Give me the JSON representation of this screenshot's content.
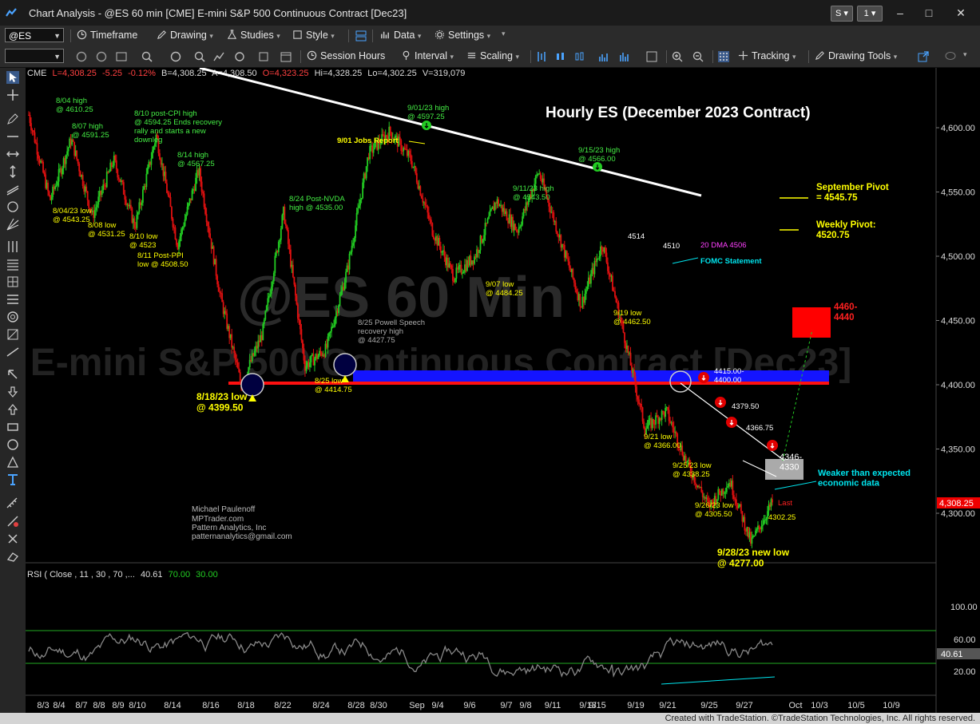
{
  "window": {
    "title": "Chart Analysis - @ES 60 min [CME] E-mini S&P 500 Continuous Contract [Dec23]",
    "btn_s": "S",
    "btn_1": "1"
  },
  "toolbar1": {
    "symbol": "@ES",
    "timeframe": "Timeframe",
    "drawing": "Drawing",
    "studies": "Studies",
    "style": "Style",
    "data": "Data",
    "settings": "Settings"
  },
  "toolbar2": {
    "session_hours": "Session Hours",
    "interval": "Interval",
    "scaling": "Scaling",
    "tracking": "Tracking",
    "drawing_tools": "Drawing Tools"
  },
  "header": {
    "exchange": "CME",
    "last": "L=4,308.25",
    "change": "-5.25",
    "pct": "-0.12%",
    "bid": "B=4,308.25",
    "ask": "A=4,308.50",
    "open": "O=4,323.25",
    "high": "Hi=4,328.25",
    "low": "Lo=4,302.25",
    "volume": "V=319,079"
  },
  "colors": {
    "up": "#22cc22",
    "down": "#e01010",
    "resistance": "#ff0000",
    "support": "#0000ff",
    "label_green": "#44ee44",
    "label_yellow": "#ffff00",
    "label_cyan": "#00e5ee"
  },
  "chart_data": {
    "type": "candlestick",
    "title": "Hourly ES (December 2023 Contract)",
    "watermark": [
      "@ES 60 Min",
      "E-mini S&P 500 Continuous Contract [Dec23]"
    ],
    "y_ticks": [
      "4,600.00",
      "4,550.00",
      "4,500.00",
      "4,450.00",
      "4,400.00",
      "4,350.00",
      "4,300.00"
    ],
    "last_price_tag": "4,308.25",
    "ylim": [
      4265,
      4640
    ],
    "x_ticks": [
      "8/3",
      "8/4",
      "8/7",
      "8/8",
      "8/9",
      "8/10",
      "8/14",
      "8/16",
      "8/18",
      "8/22",
      "8/24",
      "8/28",
      "8/30",
      "Sep",
      "9/4",
      "9/6",
      "9/7",
      "9/8",
      "9/11",
      "9/13",
      "9/15",
      "9/19",
      "9/21",
      "9/25",
      "9/27",
      "Oct",
      "10/3",
      "10/5",
      "10/9"
    ],
    "series": [
      {
        "date": "8/3",
        "close": 4610
      },
      {
        "date": "8/4",
        "close": 4543.25
      },
      {
        "date": "8/7",
        "close": 4591.25
      },
      {
        "date": "8/8",
        "close": 4531.25
      },
      {
        "date": "8/9",
        "close": 4575
      },
      {
        "date": "8/10",
        "close": 4523
      },
      {
        "date": "8/10",
        "close": 4594.25
      },
      {
        "date": "8/11",
        "close": 4508.5
      },
      {
        "date": "8/14",
        "close": 4567.25
      },
      {
        "date": "8/16",
        "close": 4470
      },
      {
        "date": "8/18",
        "close": 4399.5
      },
      {
        "date": "8/22",
        "close": 4440
      },
      {
        "date": "8/24",
        "close": 4535
      },
      {
        "date": "8/25",
        "close": 4414.75
      },
      {
        "date": "8/25",
        "close": 4427.75
      },
      {
        "date": "8/28",
        "close": 4490
      },
      {
        "date": "8/30",
        "close": 4580
      },
      {
        "date": "Sep",
        "close": 4597.25
      },
      {
        "date": "9/4",
        "close": 4575
      },
      {
        "date": "9/6",
        "close": 4520
      },
      {
        "date": "9/7",
        "close": 4484.25
      },
      {
        "date": "9/8",
        "close": 4500
      },
      {
        "date": "9/11",
        "close": 4543.5
      },
      {
        "date": "9/13",
        "close": 4520
      },
      {
        "date": "9/15",
        "close": 4566
      },
      {
        "date": "9/15",
        "close": 4514
      },
      {
        "date": "9/19",
        "close": 4462.5
      },
      {
        "date": "9/19",
        "close": 4510
      },
      {
        "date": "9/21",
        "close": 4440
      },
      {
        "date": "9/21",
        "close": 4366
      },
      {
        "date": "9/22",
        "close": 4379.5
      },
      {
        "date": "9/25",
        "close": 4338.25
      },
      {
        "date": "9/26",
        "close": 4305.5
      },
      {
        "date": "9/27",
        "close": 4325
      },
      {
        "date": "9/28",
        "close": 4277
      },
      {
        "date": "9/28",
        "close": 4308.25
      }
    ],
    "annotations": [
      {
        "text": "8/04 high",
        "text2": "@ 4610.25",
        "color": "green"
      },
      {
        "text": "8/07 high",
        "text2": "@ 4591.25",
        "color": "green"
      },
      {
        "text": "8/10 post-CPI high",
        "text2": "@ 4594.25 Ends recovery",
        "text3": "rally and starts a new",
        "text4": "downleg",
        "color": "green"
      },
      {
        "text": "8/14 high",
        "text2": "@ 4567.25",
        "color": "green"
      },
      {
        "text": "8/04/23 low",
        "text2": "@ 4543.25",
        "color": "yellow"
      },
      {
        "text": "8/08 low",
        "text2": "@ 4531.25",
        "color": "yellow"
      },
      {
        "text": "8/10 low",
        "text2": "@ 4523",
        "color": "yellow"
      },
      {
        "text": "8/11 Post-PPI",
        "text2": "low @ 4508.50",
        "color": "yellow"
      },
      {
        "text": "8/24 Post-NVDA",
        "text2": "high @ 4535.00",
        "color": "green"
      },
      {
        "text": "9/01/23 high",
        "text2": "@ 4597.25",
        "color": "green"
      },
      {
        "text": "9/01 Jobs Report",
        "color": "yellow"
      },
      {
        "text": "9/11/23 high",
        "text2": "@ 4543.50",
        "color": "green"
      },
      {
        "text": "9/15/23 high",
        "text2": "@ 4566.00",
        "color": "green"
      },
      {
        "text": "9/07 low",
        "text2": "@ 4484.25",
        "color": "yellow"
      },
      {
        "text": "4514",
        "color": "white"
      },
      {
        "text": "4510",
        "color": "white"
      },
      {
        "text": "20 DMA 4506",
        "color": "magenta"
      },
      {
        "text": "FOMC Statement",
        "color": "cyan"
      },
      {
        "text": "9/19 low",
        "text2": "@ 4462.50",
        "color": "yellow"
      },
      {
        "text": "8/25 Powell Speech",
        "text2": "recovery high",
        "text3": "@ 4427.75",
        "color": "gray"
      },
      {
        "text": "8/25 low",
        "text2": "@ 4414.75",
        "color": "yellow"
      },
      {
        "text": "8/18/23 low",
        "text2": "@ 4399.50",
        "color": "yellow"
      },
      {
        "text": "4415.00-",
        "text2": "4400.00",
        "color": "white"
      },
      {
        "text": "4379.50",
        "color": "white"
      },
      {
        "text": "4366.75",
        "color": "white"
      },
      {
        "text": "9/21 low",
        "text2": "@ 4366.00",
        "color": "yellow"
      },
      {
        "text": "9/25/23 low",
        "text2": "@ 4338.25",
        "color": "yellow"
      },
      {
        "text": "4346-",
        "text2": "4330",
        "color": "white"
      },
      {
        "text": "Weaker than expected",
        "text2": "economic data",
        "color": "cyan"
      },
      {
        "text": "9/26/23 low",
        "text2": "@ 4305.50",
        "color": "yellow"
      },
      {
        "text": "4302.25",
        "color": "yellow"
      },
      {
        "text": "Last",
        "color": "red"
      },
      {
        "text": "9/28/23 new low",
        "text2": "@ 4277.00",
        "color": "yellow"
      },
      {
        "text": "4460-",
        "text2": "4440",
        "color": "red"
      },
      {
        "text": "September Pivot",
        "text2": "= 4545.75",
        "color": "yellow"
      },
      {
        "text": "Weekly Pivot:",
        "text2": "4520.75",
        "color": "yellow"
      }
    ],
    "author": [
      "Michael Paulenoff",
      "MPTrader.com",
      "Pattern Analytics, Inc",
      "patternanalytics@gmail.com"
    ],
    "rsi": {
      "label": "RSI ( Close , 11 , 30 , 70 ,...",
      "value": "40.61",
      "upper": "70.00",
      "lower": "30.00",
      "y_ticks": [
        "100.00",
        "60.00",
        "20.00"
      ],
      "value_tag": "40.61"
    }
  },
  "status_bar": {
    "text": "Created with TradeStation. ©TradeStation Technologies, Inc. All rights reserved."
  }
}
